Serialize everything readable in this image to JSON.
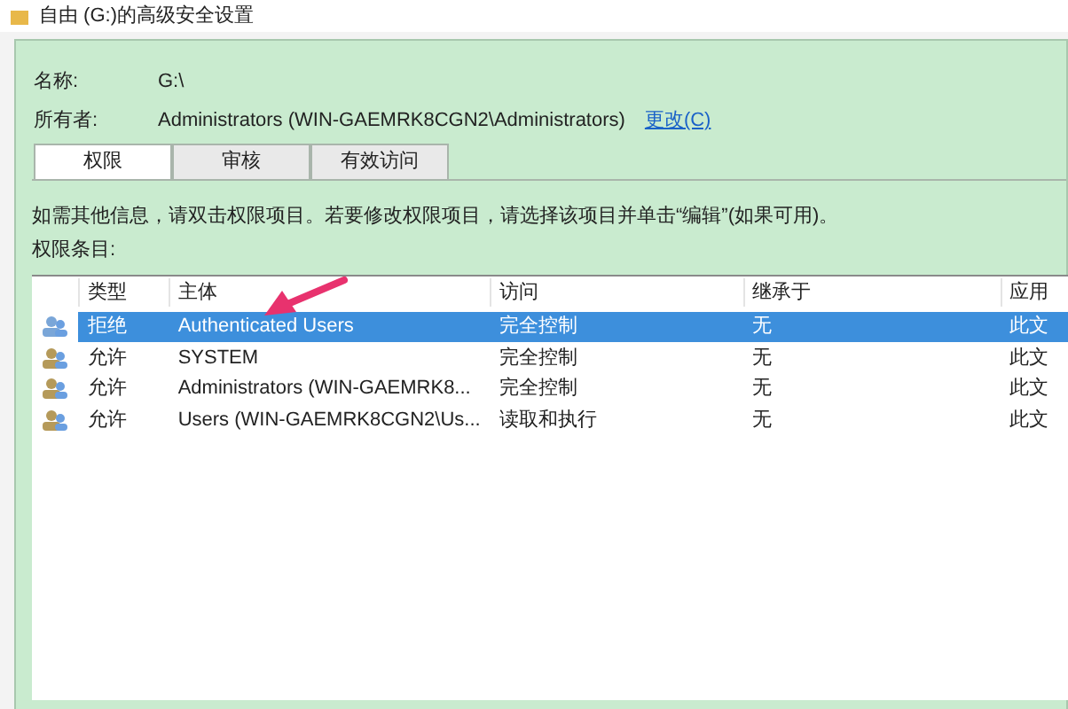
{
  "window": {
    "title": "自由 (G:)的高级安全设置"
  },
  "name": {
    "label": "名称:",
    "value": "G:\\"
  },
  "owner": {
    "label": "所有者:",
    "value": "Administrators (WIN-GAEMRK8CGN2\\Administrators)",
    "link": "更改(C)"
  },
  "tabs": [
    {
      "label": "权限",
      "selected": true
    },
    {
      "label": "审核",
      "selected": false
    },
    {
      "label": "有效访问",
      "selected": false
    }
  ],
  "info": "如需其他信息，请双击权限项目。若要修改权限项目，请选择该项目并单击“编辑”(如果可用)。",
  "entries_label": "权限条目:",
  "table": {
    "columns": [
      "类型",
      "主体",
      "访问",
      "继承于",
      "应用"
    ],
    "rows": [
      {
        "selected": true,
        "cells": [
          "拒绝",
          "Authenticated Users",
          "完全控制",
          "无",
          "此文"
        ]
      },
      {
        "selected": false,
        "cells": [
          "允许",
          "SYSTEM",
          "完全控制",
          "无",
          "此文"
        ]
      },
      {
        "selected": false,
        "cells": [
          "允许",
          "Administrators (WIN-GAEMRK8...",
          "完全控制",
          "无",
          "此文"
        ]
      },
      {
        "selected": false,
        "cells": [
          "允许",
          "Users (WIN-GAEMRK8CGN2\\Us...",
          "读取和执行",
          "无",
          "此文"
        ]
      }
    ]
  }
}
